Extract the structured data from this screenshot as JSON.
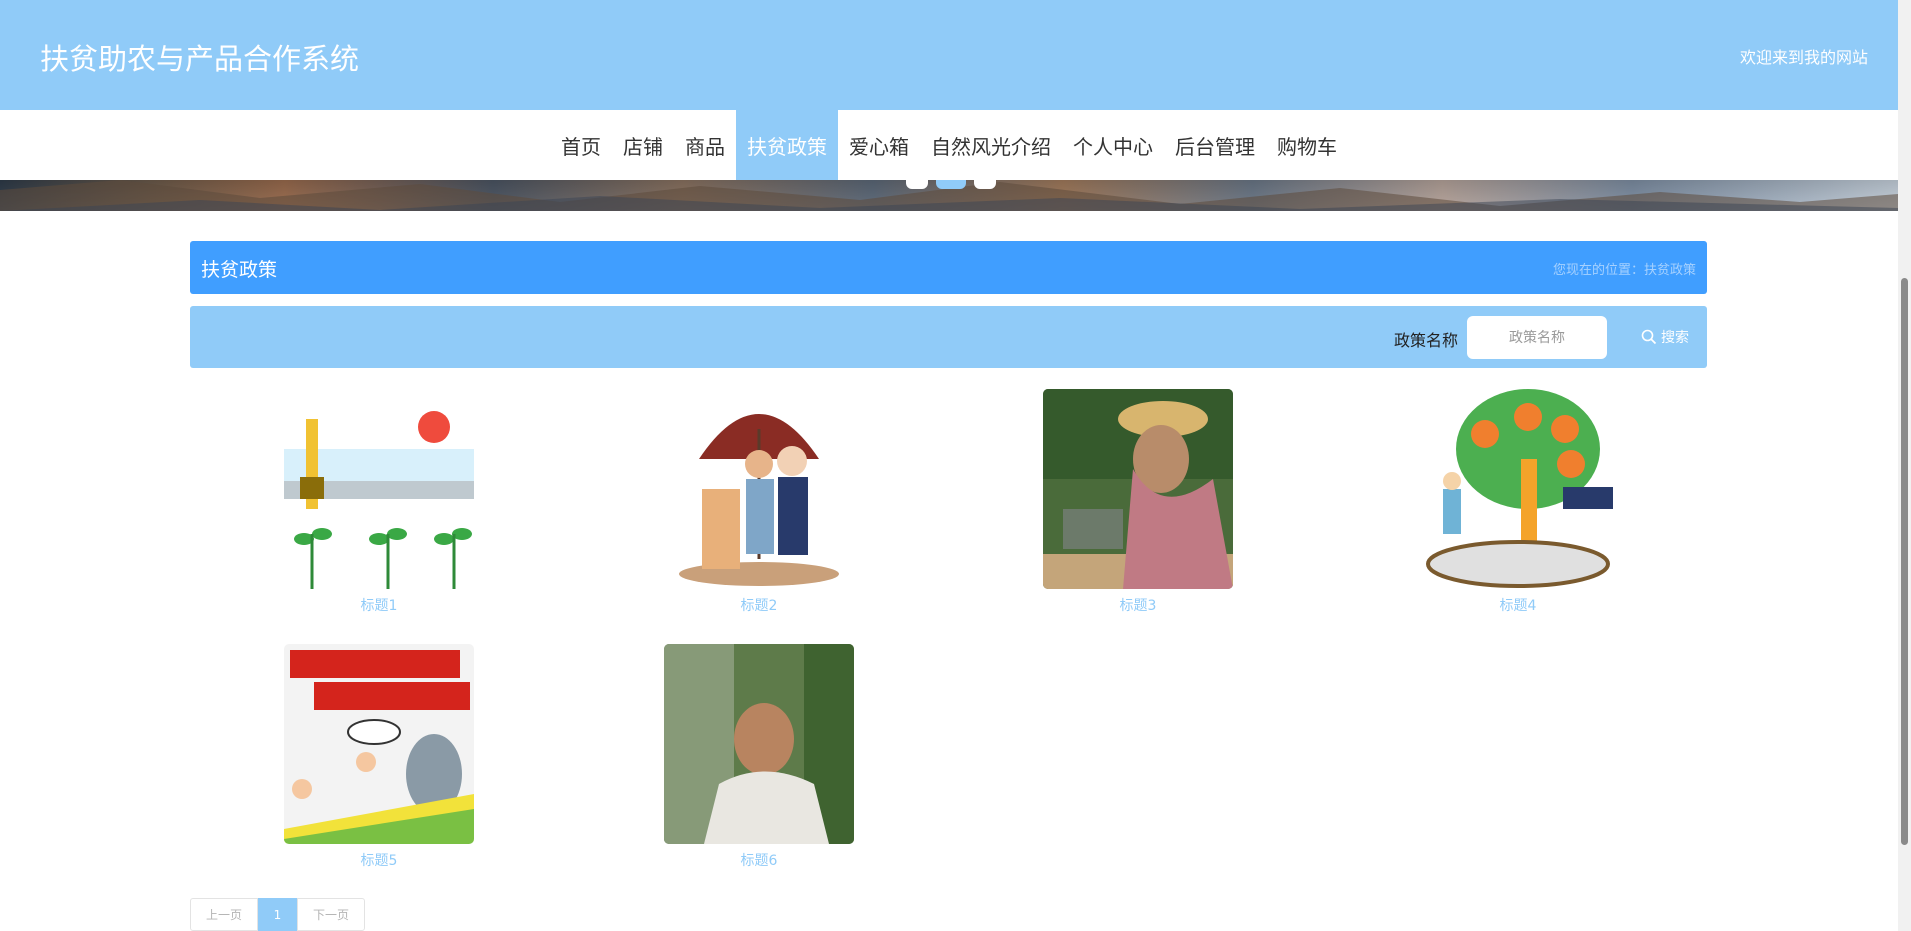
{
  "header": {
    "title": "扶贫助农与产品合作系统",
    "welcome": "欢迎来到我的网站"
  },
  "nav": {
    "items": [
      {
        "label": "首页"
      },
      {
        "label": "店铺"
      },
      {
        "label": "商品"
      },
      {
        "label": "扶贫政策",
        "active": true
      },
      {
        "label": "爱心箱"
      },
      {
        "label": "自然风光介绍"
      },
      {
        "label": "个人中心"
      },
      {
        "label": "后台管理"
      },
      {
        "label": "购物车"
      }
    ]
  },
  "page": {
    "title": "扶贫政策",
    "breadcrumb": "您现在的位置：扶贫政策"
  },
  "search": {
    "label": "政策名称",
    "placeholder": "政策名称",
    "button": "搜索"
  },
  "policies": [
    {
      "title": "标题1"
    },
    {
      "title": "标题2"
    },
    {
      "title": "标题3"
    },
    {
      "title": "标题4"
    },
    {
      "title": "标题5"
    },
    {
      "title": "标题6"
    }
  ],
  "pagination": {
    "prev": "上一页",
    "current": "1",
    "next": "下一页"
  },
  "colors": {
    "brand": "#90cbf8",
    "accent": "#409eff"
  }
}
